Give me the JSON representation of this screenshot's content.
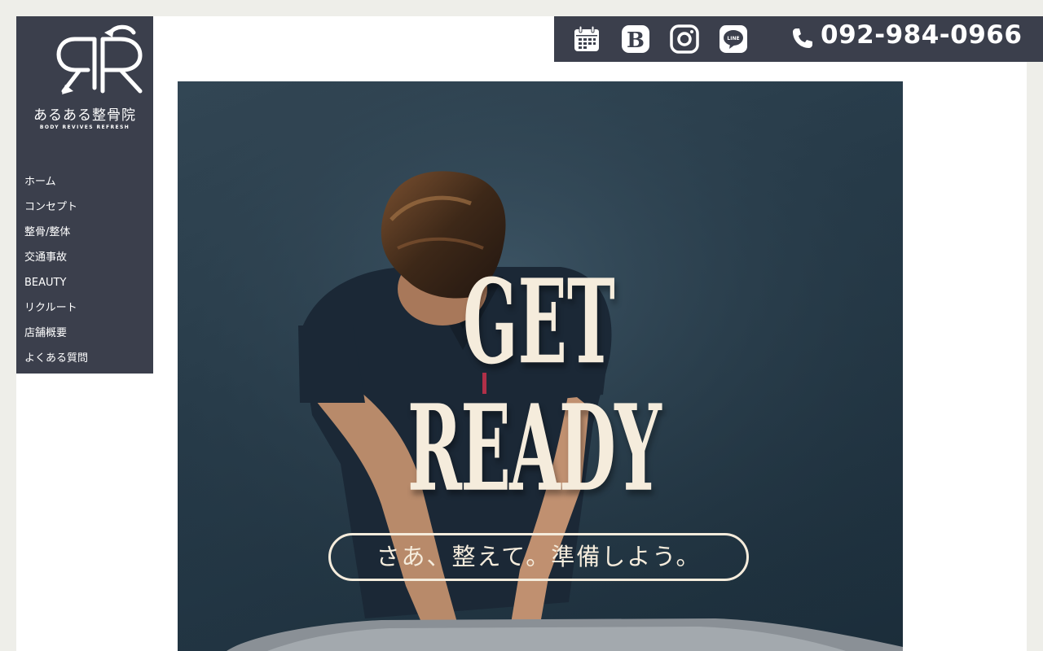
{
  "brand": {
    "name_jp": "あるある整骨院",
    "tagline_en": "BODY REVIVES REFRESH"
  },
  "nav": {
    "items": [
      {
        "label": "ホーム"
      },
      {
        "label": "コンセプト"
      },
      {
        "label": "整骨/整体"
      },
      {
        "label": "交通事故"
      },
      {
        "label": "BEAUTY"
      },
      {
        "label": "リクルート"
      },
      {
        "label": "店舗概要"
      },
      {
        "label": "よくある質問"
      }
    ]
  },
  "topbar": {
    "icons": [
      "calendar-icon",
      "beauty-b-icon",
      "instagram-icon",
      "line-icon"
    ],
    "phone": "092-984-0966"
  },
  "hero": {
    "title_line1": "GET",
    "title_line2": "READY",
    "subtitle": "さあ、整えて。準備しよう。"
  },
  "colors": {
    "sidebar": "#3b3f4c",
    "hero_text": "#f5ecdc",
    "page_bg": "#eeeee9"
  }
}
